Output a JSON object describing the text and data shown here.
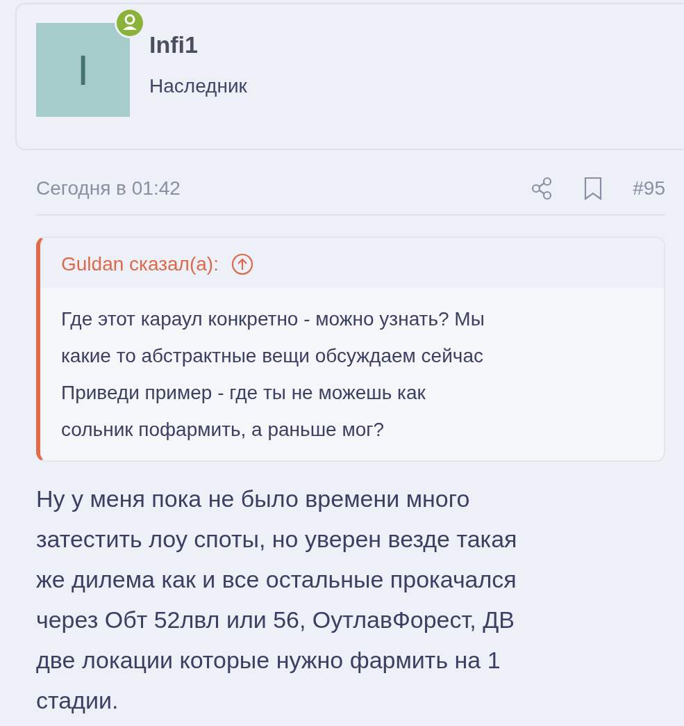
{
  "author": {
    "avatar_letter": "I",
    "online": true,
    "name": "Infi1",
    "title": "Наследник"
  },
  "post": {
    "date": "Сегодня в 01:42",
    "number": "#95",
    "quote": {
      "author_line": "Guldan сказал(а):",
      "text": "Где этот караул конкретно - можно узнать? Мы\nкакие то абстрактные вещи обсуждаем сейчас\nПриведи пример - где ты не можешь как\nсольник пофармить, а раньше мог?"
    },
    "body": "Ну у меня пока не было времени много\nзатестить лоу споты, но уверен везде такая\nже дилема как и все остальные прокачался\nчерез Обт 52лвл или 56, ОутлавФорест, ДВ\nдве локации которые нужно фармить на 1\nстадии."
  }
}
